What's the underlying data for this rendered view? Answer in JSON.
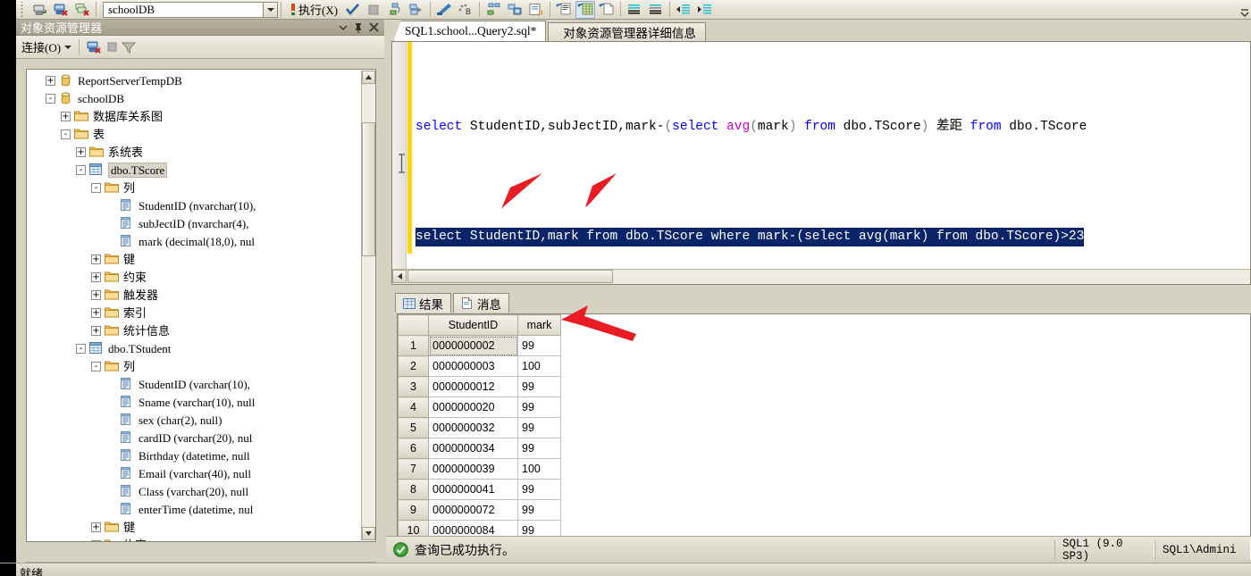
{
  "toolbar": {
    "database_combo_value": "schoolDB",
    "execute_label": "执行(X)",
    "icons": [
      "connect-object-explorer-icon",
      "disconnect-icon",
      "disconnect-all-icon",
      "parse-check-icon",
      "stop-icon",
      "debug-icon",
      "tools-icon",
      "design-query-icon",
      "sqlcmd-mode-icon",
      "include-actual-plan-icon",
      "include-client-stats-icon",
      "results-to-text-icon",
      "results-to-grid-icon",
      "results-to-file-icon",
      "comment-icon",
      "uncomment-icon",
      "decrease-indent-icon",
      "increase-indent-icon"
    ]
  },
  "object_explorer": {
    "title": "对象资源管理器",
    "connect_label": "连接(O)",
    "tree": [
      {
        "indent": 1,
        "expander": "+",
        "icon": "database-icon",
        "label": "ReportServerTempDB",
        "selected": false
      },
      {
        "indent": 1,
        "expander": "-",
        "icon": "database-icon",
        "label": "schoolDB",
        "selected": false
      },
      {
        "indent": 2,
        "expander": "+",
        "icon": "folder-icon",
        "label": "数据库关系图",
        "selected": false
      },
      {
        "indent": 2,
        "expander": "-",
        "icon": "folder-icon",
        "label": "表",
        "selected": false
      },
      {
        "indent": 3,
        "expander": "+",
        "icon": "folder-icon",
        "label": "系统表",
        "selected": false
      },
      {
        "indent": 3,
        "expander": "-",
        "icon": "table-icon",
        "label": "dbo.TScore",
        "selected": true
      },
      {
        "indent": 4,
        "expander": "-",
        "icon": "folder-icon",
        "label": "列",
        "selected": false
      },
      {
        "indent": 5,
        "expander": "",
        "icon": "column-icon",
        "label": "StudentID (nvarchar(10),",
        "selected": false
      },
      {
        "indent": 5,
        "expander": "",
        "icon": "column-icon",
        "label": "subJectID (nvarchar(4),",
        "selected": false
      },
      {
        "indent": 5,
        "expander": "",
        "icon": "column-icon",
        "label": "mark (decimal(18,0), nul",
        "selected": false
      },
      {
        "indent": 4,
        "expander": "+",
        "icon": "folder-icon",
        "label": "键",
        "selected": false
      },
      {
        "indent": 4,
        "expander": "+",
        "icon": "folder-icon",
        "label": "约束",
        "selected": false
      },
      {
        "indent": 4,
        "expander": "+",
        "icon": "folder-icon",
        "label": "触发器",
        "selected": false
      },
      {
        "indent": 4,
        "expander": "+",
        "icon": "folder-icon",
        "label": "索引",
        "selected": false
      },
      {
        "indent": 4,
        "expander": "+",
        "icon": "folder-icon",
        "label": "统计信息",
        "selected": false
      },
      {
        "indent": 3,
        "expander": "-",
        "icon": "table-icon",
        "label": "dbo.TStudent",
        "selected": false
      },
      {
        "indent": 4,
        "expander": "-",
        "icon": "folder-icon",
        "label": "列",
        "selected": false
      },
      {
        "indent": 5,
        "expander": "",
        "icon": "column-icon",
        "label": "StudentID (varchar(10),",
        "selected": false
      },
      {
        "indent": 5,
        "expander": "",
        "icon": "column-icon",
        "label": "Sname (varchar(10), null",
        "selected": false
      },
      {
        "indent": 5,
        "expander": "",
        "icon": "column-icon",
        "label": "sex (char(2), null)",
        "selected": false
      },
      {
        "indent": 5,
        "expander": "",
        "icon": "column-icon",
        "label": "cardID (varchar(20), nul",
        "selected": false
      },
      {
        "indent": 5,
        "expander": "",
        "icon": "column-icon",
        "label": "Birthday (datetime, null",
        "selected": false
      },
      {
        "indent": 5,
        "expander": "",
        "icon": "column-icon",
        "label": "Email (varchar(40), null",
        "selected": false
      },
      {
        "indent": 5,
        "expander": "",
        "icon": "column-icon",
        "label": "Class (varchar(20), null",
        "selected": false
      },
      {
        "indent": 5,
        "expander": "",
        "icon": "column-icon",
        "label": "enterTime (datetime, nul",
        "selected": false
      },
      {
        "indent": 4,
        "expander": "+",
        "icon": "folder-icon",
        "label": "键",
        "selected": false
      },
      {
        "indent": 4,
        "expander": "-",
        "icon": "folder-icon",
        "label": "约束",
        "selected": false
      }
    ]
  },
  "tabs": [
    {
      "label": "SQL1.school...Query2.sql*",
      "active": true
    },
    {
      "label": "对象资源管理器详细信息",
      "active": false
    }
  ],
  "editor": {
    "line1": [
      {
        "t": "select ",
        "c": "kw"
      },
      {
        "t": "StudentID,subJectID,mark-",
        "c": ""
      },
      {
        "t": "(",
        "c": "punct"
      },
      {
        "t": "select ",
        "c": "kw"
      },
      {
        "t": "avg",
        "c": "fn"
      },
      {
        "t": "(",
        "c": "punct"
      },
      {
        "t": "mark",
        "c": ""
      },
      {
        "t": ")",
        "c": "punct"
      },
      {
        "t": " from ",
        "c": "kw"
      },
      {
        "t": "dbo.TScore",
        "c": ""
      },
      {
        "t": ")",
        "c": "punct"
      },
      {
        "t": " 差距 ",
        "c": ""
      },
      {
        "t": "from ",
        "c": "kw"
      },
      {
        "t": "dbo.TScore",
        "c": ""
      }
    ],
    "line2_selected": "select StudentID,mark from dbo.TScore where mark-(select avg(mark) from dbo.TScore)>23"
  },
  "results": {
    "tabs": [
      {
        "label": "结果",
        "icon": "grid-icon",
        "active": true
      },
      {
        "label": "消息",
        "icon": "message-icon",
        "active": false
      }
    ],
    "columns": [
      "",
      "StudentID",
      "mark"
    ],
    "rows": [
      {
        "n": "1",
        "StudentID": "0000000002",
        "mark": "99"
      },
      {
        "n": "2",
        "StudentID": "0000000003",
        "mark": "100"
      },
      {
        "n": "3",
        "StudentID": "0000000012",
        "mark": "99"
      },
      {
        "n": "4",
        "StudentID": "0000000020",
        "mark": "99"
      },
      {
        "n": "5",
        "StudentID": "0000000032",
        "mark": "99"
      },
      {
        "n": "6",
        "StudentID": "0000000034",
        "mark": "99"
      },
      {
        "n": "7",
        "StudentID": "0000000039",
        "mark": "100"
      },
      {
        "n": "8",
        "StudentID": "0000000041",
        "mark": "99"
      },
      {
        "n": "9",
        "StudentID": "0000000072",
        "mark": "99"
      },
      {
        "n": "10",
        "StudentID": "0000000084",
        "mark": "99"
      }
    ]
  },
  "statusbar": {
    "message": "查询已成功执行。",
    "server": "SQL1 (9.0 SP3)",
    "user": "SQL1\\Admini"
  },
  "bottom": {
    "ready": "就绪"
  },
  "colors": {
    "keyword": "#0000ff",
    "function": "#cc00cc",
    "selection": "#0a246a",
    "change_bar": "#ffd400",
    "annotation_arrow": "#e81c22"
  }
}
